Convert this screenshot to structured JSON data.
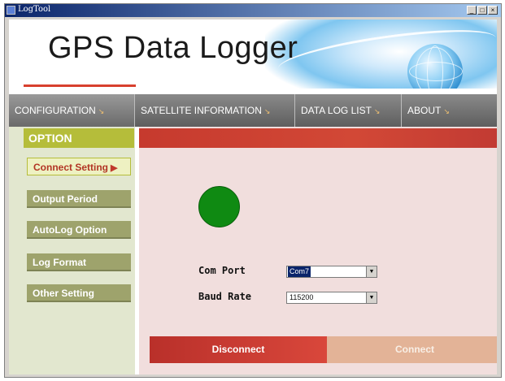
{
  "window": {
    "title": "LogTool",
    "buttons": [
      "_",
      "□",
      "×"
    ]
  },
  "banner": {
    "title": "GPS Data Logger"
  },
  "nav": {
    "tabs": [
      {
        "label": "CONFIGURATION",
        "arrow": "↘"
      },
      {
        "label": "SATELLITE INFORMATION",
        "arrow": "↘"
      },
      {
        "label": "DATA LOG LIST",
        "arrow": "↘"
      },
      {
        "label": "ABOUT",
        "arrow": "↘"
      }
    ]
  },
  "sidebar": {
    "header": "OPTION",
    "items": [
      {
        "label": "Connect Setting",
        "indicator": "▶"
      },
      {
        "label": "Output Period"
      },
      {
        "label": "AutoLog Option"
      },
      {
        "label": "Log Format"
      },
      {
        "label": "Other Setting"
      }
    ]
  },
  "connection": {
    "status_color": "#0f8a12",
    "com_port": {
      "label": "Com Port",
      "value": "Com7"
    },
    "baud_rate": {
      "label": "Baud Rate",
      "value": "115200"
    },
    "disconnect_label": "Disconnect",
    "connect_label": "Connect"
  }
}
